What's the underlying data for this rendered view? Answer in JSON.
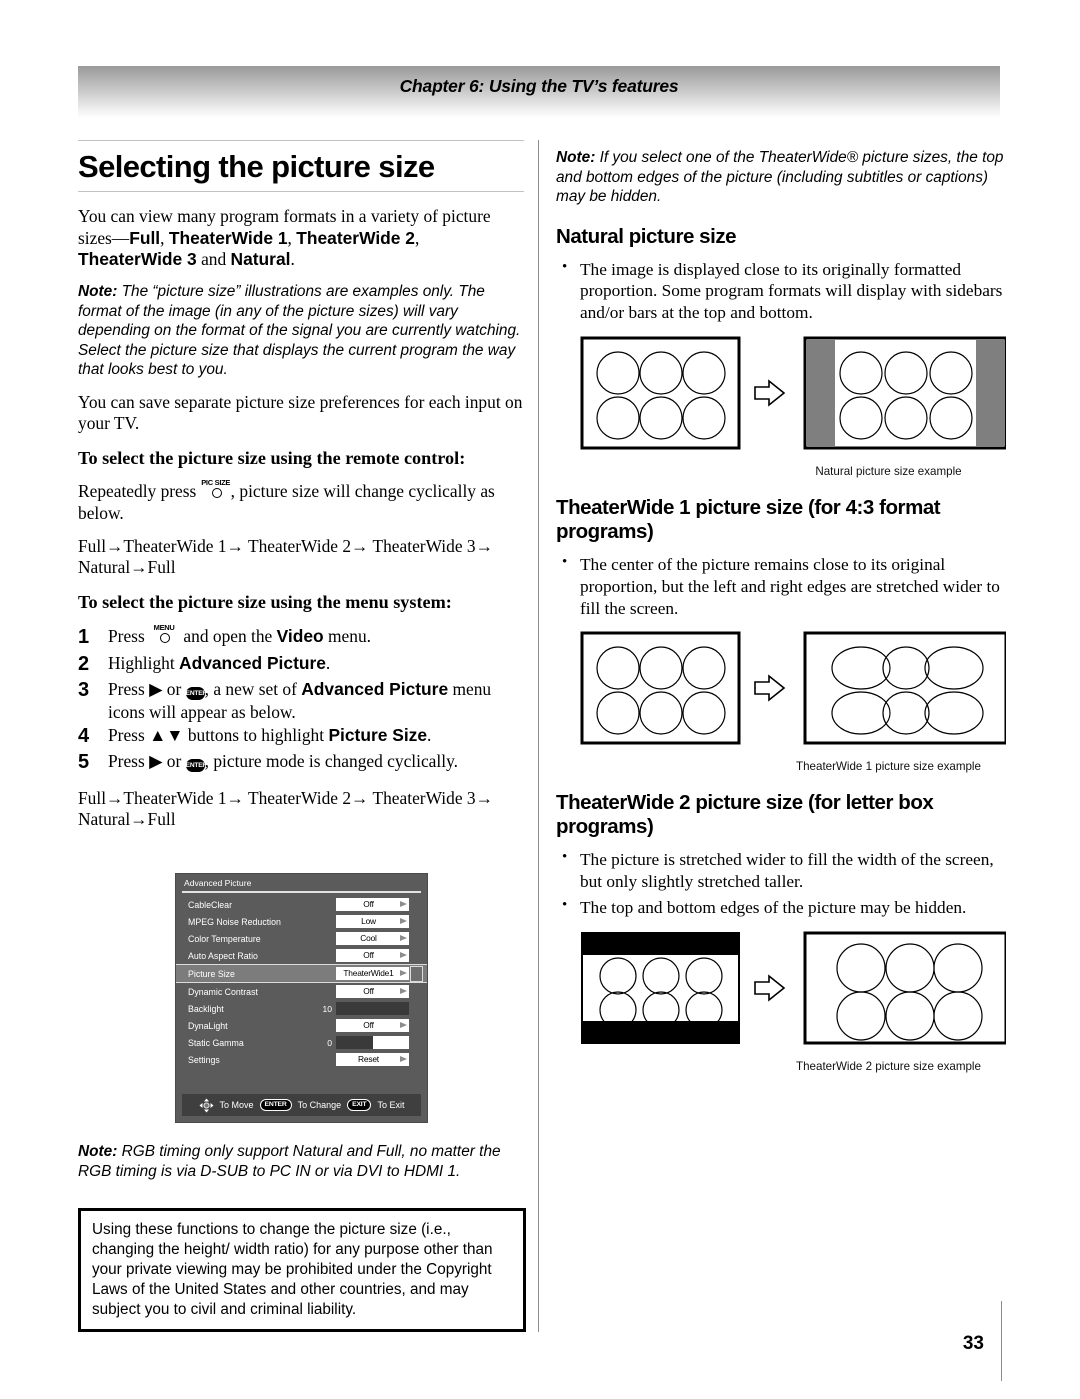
{
  "header": {
    "chapter_title": "Chapter 6: Using the TV’s features"
  },
  "page_number": "33",
  "left_column": {
    "title": "Selecting the picture size",
    "intro_p1_a": "You can view many program formats in a variety of picture sizes—",
    "intro_bold_1": "Full",
    "intro_sep_1": ", ",
    "intro_bold_2": "TheaterWide 1",
    "intro_sep_2": ", ",
    "intro_bold_3": "TheaterWide 2",
    "intro_sep_3": ", ",
    "intro_bold_4": "TheaterWide 3",
    "intro_and": " and ",
    "intro_bold_5": "Natural",
    "intro_end": ".",
    "note_label": "Note:",
    "note_text": " The “picture size” illustrations are examples only. The format of the image (in any of the picture sizes) will vary depending on the format of the signal you are currently watching. Select the picture size that displays the current program the way that looks best to you.",
    "save_pref": "You can save separate picture size preferences for each input on your TV.",
    "subhead_remote": "To select the picture size using the remote control:",
    "repeat_a": "Repeatedly press ",
    "repeat_b": ", picture size will change cyclically as below.",
    "pic_size_key": "PIC SIZE",
    "cycle_line1": "Full→TheaterWide 1→ TheaterWide 2→ TheaterWide 3→",
    "cycle_line2": "Natural→Full",
    "subhead_menu": "To select the picture size using the menu system:",
    "menu_key": "MENU",
    "steps": [
      {
        "num": "1",
        "pre": "Press ",
        "mid": " and open the ",
        "bold": "Video",
        "post": " menu."
      },
      {
        "num": "2",
        "pre": "Highlight ",
        "bold": "Advanced Picture",
        "post": "."
      },
      {
        "num": "3",
        "pre": "Press ▶ or ",
        "mid": ", a new set of ",
        "bold": "Advanced Picture",
        "post": " menu icons will appear as below.",
        "enter": "ENTER"
      },
      {
        "num": "4",
        "pre": "Press ▲▼ buttons to highlight ",
        "bold": "Picture Size",
        "post": "."
      },
      {
        "num": "5",
        "pre": "Press ▶ or ",
        "mid": ", picture mode is changed cyclically.",
        "bold": "",
        "post": "",
        "enter": "ENTER"
      }
    ],
    "cycle2_line1": "Full→TheaterWide 1→ TheaterWide 2→ TheaterWide 3→",
    "cycle2_line2": "Natural→Full",
    "note2_label": "Note:",
    "note2_text": " RGB timing only support Natural and Full, no matter the RGB timing is via D-SUB to PC IN or via DVI to HDMI 1.",
    "warning_box": "Using these functions to change the picture size (i.e., changing the height/ width ratio) for any purpose other than your private viewing may be prohibited under the Copyright Laws of the United States and other countries, and may subject you to civil and criminal liability."
  },
  "osd_menu": {
    "title": "Advanced Picture",
    "rows": [
      {
        "label": "CableClear",
        "type": "select",
        "value": "Off"
      },
      {
        "label": "MPEG Noise Reduction",
        "type": "select",
        "value": "Low"
      },
      {
        "label": "Color Temperature",
        "type": "select",
        "value": "Cool"
      },
      {
        "label": "Auto Aspect Ratio",
        "type": "select",
        "value": "Off"
      },
      {
        "label": "Picture Size",
        "type": "select",
        "value": "TheaterWide1",
        "highlighted": true
      },
      {
        "label": "Dynamic Contrast",
        "type": "select",
        "value": "Off"
      },
      {
        "label": "Backlight",
        "type": "slider",
        "value": "10",
        "fill_pct": 100
      },
      {
        "label": "DynaLight",
        "type": "select",
        "value": "Off"
      },
      {
        "label": "Static Gamma",
        "type": "slider",
        "value": "0",
        "fill_pct": 50
      },
      {
        "label": "Settings",
        "type": "select",
        "value": "Reset"
      }
    ],
    "footer": {
      "move_label": "To Move",
      "enter_key": "ENTER",
      "change_label": "To Change",
      "exit_key": "EXIT",
      "exit_label": "To Exit"
    }
  },
  "right_column": {
    "note_label": "Note:",
    "note_text": " If you select one of the TheaterWide® picture sizes, the top and bottom edges of the picture (including subtitles or captions) may be hidden.",
    "sections": [
      {
        "heading": "Natural picture size",
        "bullets": [
          "The image is displayed close to its originally formatted proportion. Some program formats will display with sidebars and/or bars at the top and bottom."
        ],
        "caption": "Natural picture size example"
      },
      {
        "heading": "TheaterWide 1 picture size (for 4:3 format programs)",
        "bullets": [
          "The center of the picture remains close to its original proportion, but the left and right edges are stretched wider to fill the screen."
        ],
        "caption": "TheaterWide 1 picture size example"
      },
      {
        "heading": "TheaterWide 2 picture size (for letter box programs)",
        "bullets": [
          "The picture is stretched wider to fill the width of the screen, but only slightly stretched taller.",
          "The top and bottom edges of the picture may be hidden."
        ],
        "caption": "TheaterWide 2 picture size example"
      }
    ]
  },
  "colors": {
    "osd_panel": "#5b5b5b",
    "osd_highlight": "#7c7c7c",
    "osd_footer": "#3f3f3f",
    "rule": "#8d8d8d",
    "sidebar_gray": "#6e6e6e"
  }
}
